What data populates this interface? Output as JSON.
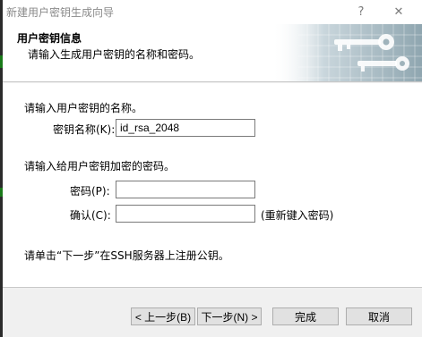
{
  "window": {
    "title": "新建用户密钥生成向导",
    "help_glyph": "?",
    "close_glyph": "✕"
  },
  "header": {
    "title": "用户密钥信息",
    "subtitle": "请输入生成用户密钥的名称和密码。"
  },
  "name_section": {
    "instruction": "请输入用户密钥的名称。",
    "label": "密钥名称(K):",
    "value": "id_rsa_2048"
  },
  "password_section": {
    "instruction": "请输入给用户密钥加密的密码。",
    "password_label": "密码(P):",
    "password_value": "",
    "confirm_label": "确认(C):",
    "confirm_value": "",
    "confirm_hint": "(重新键入密码)"
  },
  "footer_note": "请单击“下一步”在SSH服务器上注册公钥。",
  "buttons": {
    "back": "< 上一步(B)",
    "next": "下一步(N) >",
    "finish": "完成",
    "cancel": "取消"
  },
  "colors": {
    "banner_key_graphic": "#8fa6b0",
    "dialog_background": "#f0f0f0"
  }
}
